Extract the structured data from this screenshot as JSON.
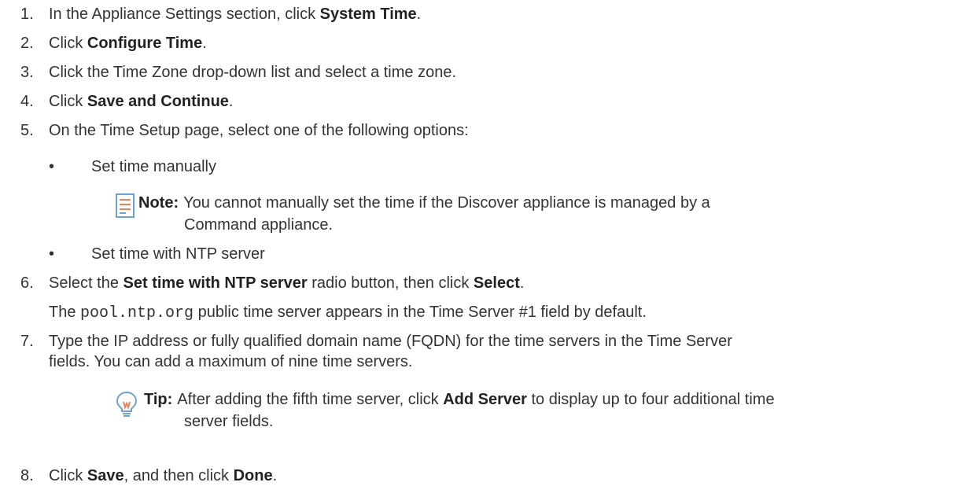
{
  "steps": [
    {
      "num": "1.",
      "pre": "In the Appliance Settings section, click ",
      "bold": "System Time",
      "post": "."
    },
    {
      "num": "2.",
      "pre": "Click ",
      "bold": "Configure Time",
      "post": "."
    },
    {
      "num": "3.",
      "text": "Click the Time Zone drop-down list and select a time zone."
    },
    {
      "num": "4.",
      "pre": "Click ",
      "bold": "Save and Continue",
      "post": "."
    },
    {
      "num": "5.",
      "text": "On the Time Setup page, select one of the following options:"
    },
    {
      "num": "6.",
      "pre": "Select the ",
      "bold": "Set time with NTP server",
      "mid": " radio button, then click ",
      "bold2": "Select",
      "post": "."
    },
    {
      "num": "7.",
      "line1": "Type the IP address or fully qualified domain name (FQDN) for the time servers in the Time Server",
      "line2": "fields. You can add a maximum of nine time servers."
    },
    {
      "num": "8.",
      "pre": "Click ",
      "bold": "Save",
      "mid": ", and then click ",
      "bold2": "Done",
      "post": "."
    }
  ],
  "options": {
    "bullet": "•",
    "manual": "Set time manually",
    "ntp": "Set time with NTP server"
  },
  "note": {
    "icon": "note-icon",
    "label": "Note:",
    "line1": "You cannot manually set the time if the Discover appliance is managed by a",
    "line2": "Command appliance."
  },
  "step6_info": {
    "pre": "The ",
    "code": "pool.ntp.org",
    "post": " public time server appears in the Time Server #1 field by default."
  },
  "tip": {
    "icon": "lightbulb-icon",
    "label": "Tip:",
    "pre": "After adding the fifth time server, click ",
    "bold": "Add Server",
    "post": " to display up to four additional time",
    "line2": "server fields."
  }
}
